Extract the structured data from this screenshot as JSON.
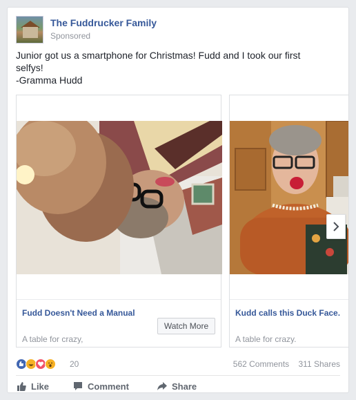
{
  "post": {
    "page_name": "The Fuddrucker Family",
    "sponsored": "Sponsored",
    "message_lines": [
      "Junior got us a smartphone for Christmas! Fudd and I took our first",
      "selfys!",
      "-Gramma Hudd"
    ]
  },
  "carousel": {
    "cards": [
      {
        "title": "Fudd Doesn't Need a Manual",
        "description": "A table for crazy,",
        "button": "Watch More"
      },
      {
        "title": "Kudd calls this Duck Face.",
        "description": "A table for crazy."
      }
    ]
  },
  "stats": {
    "reactions_count": "20",
    "comments": "562 Comments",
    "shares": "311 Shares",
    "reaction_icons": [
      "like-icon",
      "haha-icon",
      "love-icon",
      "wow-icon"
    ]
  },
  "actions": {
    "like": "Like",
    "comment": "Comment",
    "share": "Share"
  },
  "colors": {
    "link": "#365899",
    "muted": "#90949c",
    "like_blue": "#4267b2",
    "love_red": "#f25268",
    "haha_yellow": "#f7b125"
  }
}
